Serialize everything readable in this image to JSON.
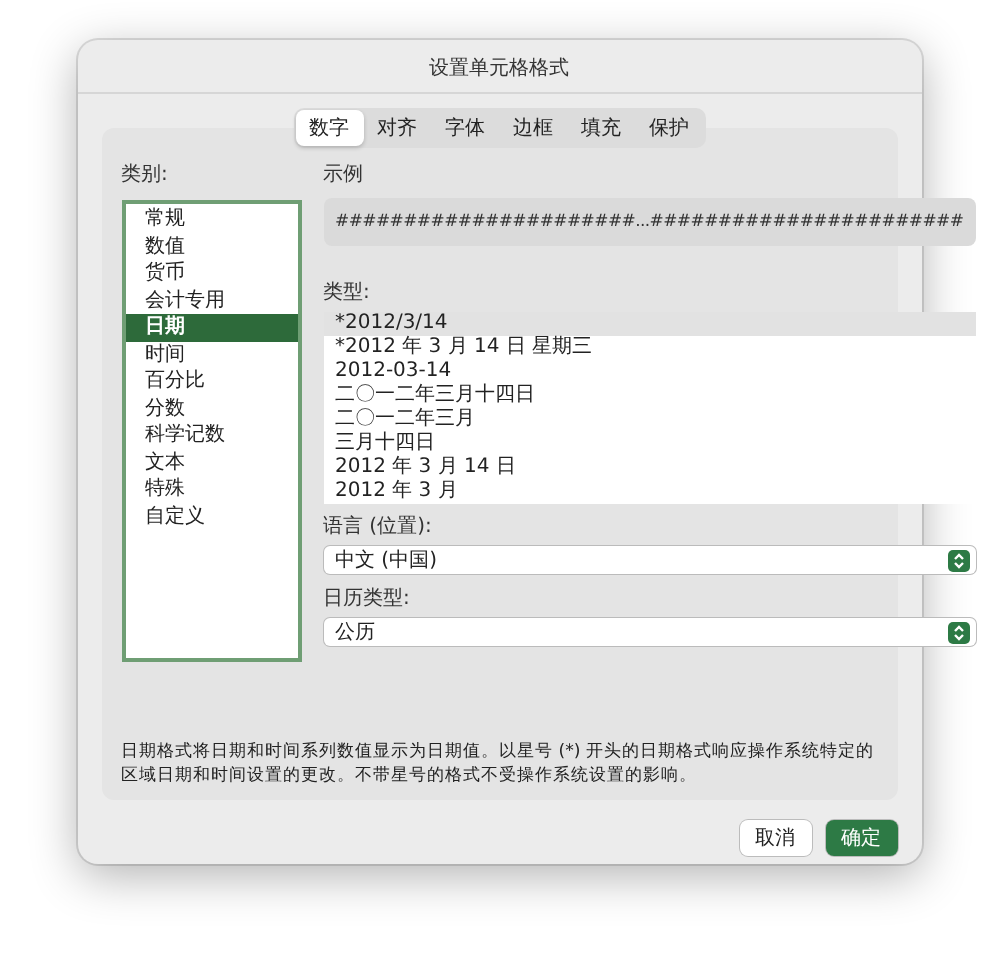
{
  "window": {
    "title": "设置单元格格式"
  },
  "tabs": [
    {
      "label": "数字",
      "selected": true
    },
    {
      "label": "对齐",
      "selected": false
    },
    {
      "label": "字体",
      "selected": false
    },
    {
      "label": "边框",
      "selected": false
    },
    {
      "label": "填充",
      "selected": false
    },
    {
      "label": "保护",
      "selected": false
    }
  ],
  "category": {
    "label": "类别:",
    "items": [
      {
        "label": "常规",
        "selected": false
      },
      {
        "label": "数值",
        "selected": false
      },
      {
        "label": "货币",
        "selected": false
      },
      {
        "label": "会计专用",
        "selected": false
      },
      {
        "label": "日期",
        "selected": true
      },
      {
        "label": "时间",
        "selected": false
      },
      {
        "label": "百分比",
        "selected": false
      },
      {
        "label": "分数",
        "selected": false
      },
      {
        "label": "科学记数",
        "selected": false
      },
      {
        "label": "文本",
        "selected": false
      },
      {
        "label": "特殊",
        "selected": false
      },
      {
        "label": "自定义",
        "selected": false
      }
    ]
  },
  "sample": {
    "label": "示例",
    "value": "######################...#######################"
  },
  "type": {
    "label": "类型:",
    "items": [
      {
        "label": "*2012/3/14",
        "selected": true
      },
      {
        "label": "*2012 年 3 月 14 日 星期三",
        "selected": false
      },
      {
        "label": "2012-03-14",
        "selected": false
      },
      {
        "label": "二〇一二年三月十四日",
        "selected": false
      },
      {
        "label": "二〇一二年三月",
        "selected": false
      },
      {
        "label": "三月十四日",
        "selected": false
      },
      {
        "label": "2012 年 3 月 14 日",
        "selected": false
      },
      {
        "label": "2012 年 3 月",
        "selected": false
      }
    ]
  },
  "locale": {
    "label": "语言 (位置):",
    "value": "中文 (中国)"
  },
  "calendar": {
    "label": "日历类型:",
    "value": "公历"
  },
  "description": "日期格式将日期和时间系列数值显示为日期值。以星号 (*) 开头的日期格式响应操作系统特定的区域日期和时间设置的更改。不带星号的格式不受操作系统设置的影响。",
  "buttons": [
    {
      "label": "取消",
      "kind": "secondary"
    },
    {
      "label": "确定",
      "kind": "primary"
    }
  ]
}
